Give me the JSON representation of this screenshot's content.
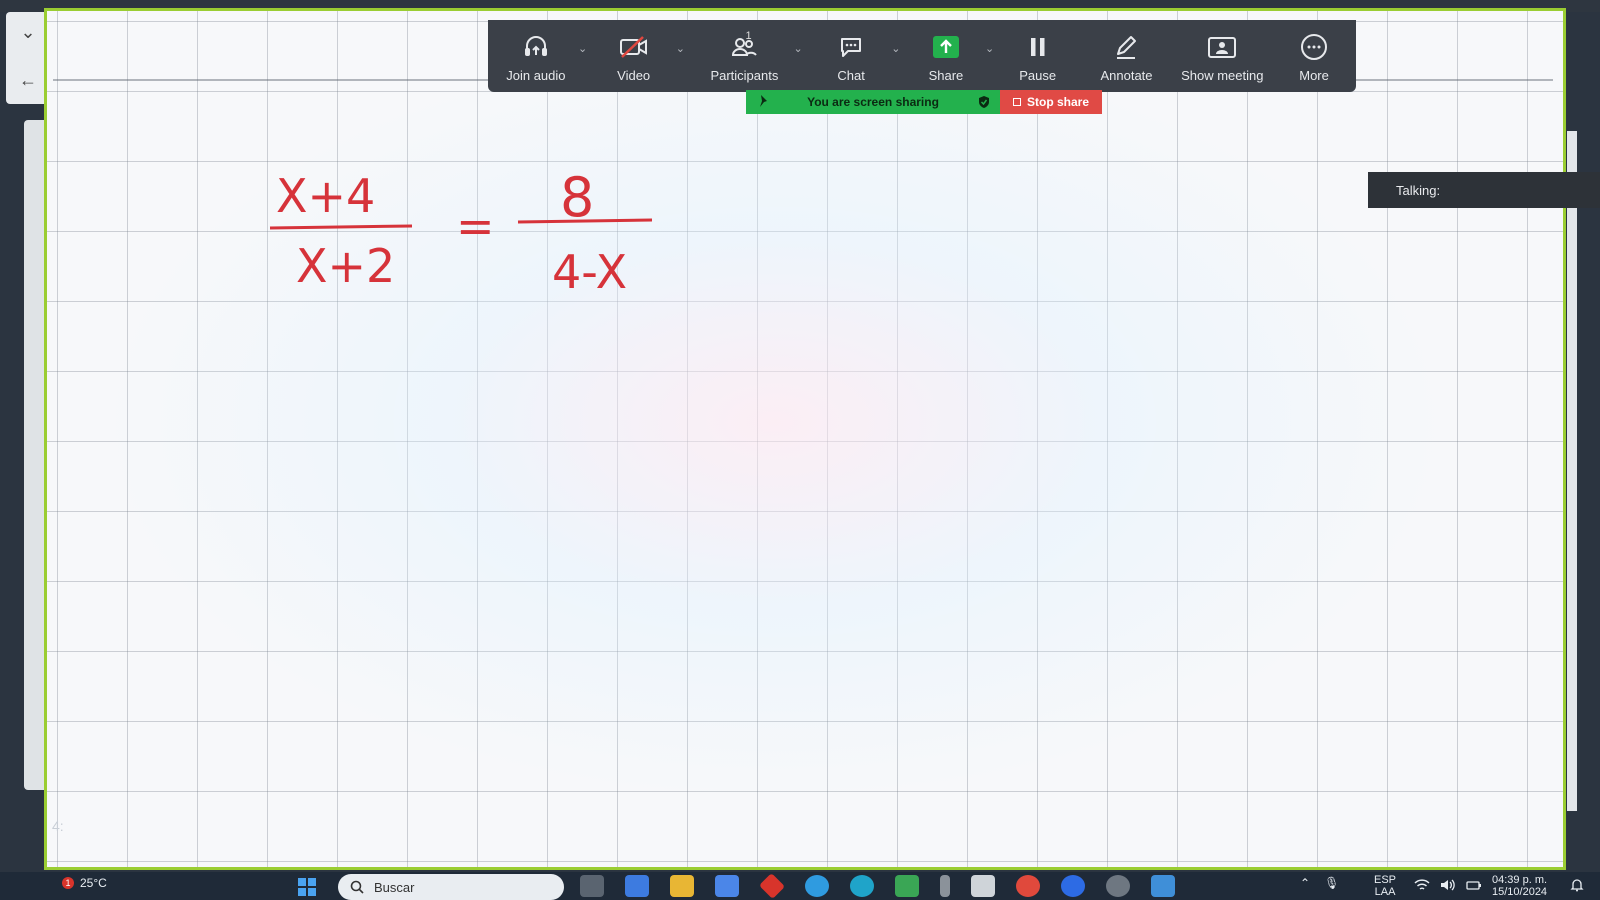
{
  "toolbar": {
    "join_audio": "Join audio",
    "video": "Video",
    "participants": "Participants",
    "participants_count": "1",
    "chat": "Chat",
    "share": "Share",
    "pause": "Pause",
    "annotate": "Annotate",
    "show_meeting": "Show meeting",
    "more": "More"
  },
  "share_bar": {
    "status": "You are screen sharing",
    "stop_label": "Stop share",
    "status_color": "#23b14d",
    "stop_color": "#e04a45"
  },
  "talking_panel": {
    "label": "Talking:"
  },
  "whiteboard": {
    "equation": {
      "left_numerator": "X+4",
      "left_denominator": "X+2",
      "equals": "=",
      "right_numerator": "8",
      "right_denominator": "4-X",
      "ink_color": "#d6333a"
    },
    "border_color": "#9acd32"
  },
  "side_time": "4:",
  "taskbar": {
    "weather_temp": "25°C",
    "weather_badge": "1",
    "search_placeholder": "Buscar",
    "language_top": "ESP",
    "language_bottom": "LAA",
    "time": "04:39 p. m.",
    "date": "15/10/2024"
  }
}
